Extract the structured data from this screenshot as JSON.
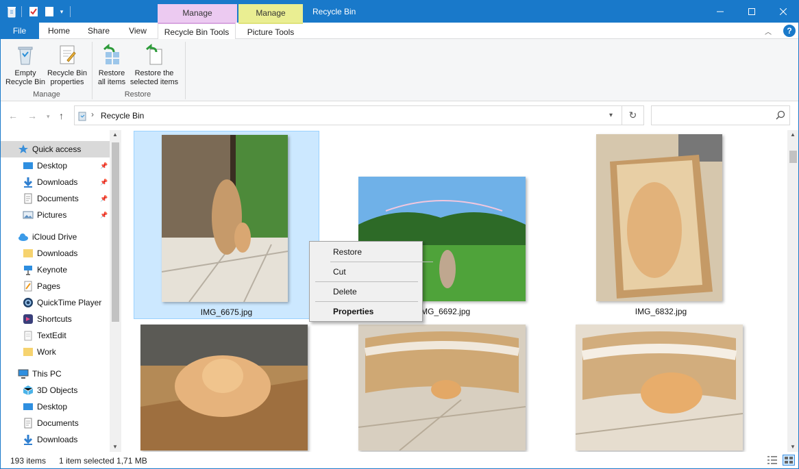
{
  "window": {
    "title": "Recycle Bin",
    "context_tabs": [
      "Manage",
      "Manage"
    ]
  },
  "ribbon_tabs": {
    "file": "File",
    "home": "Home",
    "share": "Share",
    "view": "View",
    "recycle_bin_tools": "Recycle Bin Tools",
    "picture_tools": "Picture Tools"
  },
  "ribbon": {
    "empty_bin": [
      "Empty",
      "Recycle Bin"
    ],
    "bin_props": [
      "Recycle Bin",
      "properties"
    ],
    "restore_all": [
      "Restore",
      "all items"
    ],
    "restore_selected": [
      "Restore the",
      "selected items"
    ],
    "group_manage": "Manage",
    "group_restore": "Restore"
  },
  "address": {
    "path": "Recycle Bin",
    "search_placeholder": ""
  },
  "nav": {
    "quick_access": "Quick access",
    "qa_items": [
      "Desktop",
      "Downloads",
      "Documents",
      "Pictures"
    ],
    "icloud": "iCloud Drive",
    "icloud_items": [
      "Downloads",
      "Keynote",
      "Pages",
      "QuickTime Player",
      "Shortcuts",
      "TextEdit",
      "Work"
    ],
    "this_pc": "This PC",
    "pc_items": [
      "3D Objects",
      "Desktop",
      "Documents",
      "Downloads"
    ]
  },
  "files": [
    {
      "name": "IMG_6675.jpg"
    },
    {
      "name": "IMG_6692.jpg"
    },
    {
      "name": "IMG_6832.jpg"
    }
  ],
  "context_menu": {
    "restore": "Restore",
    "cut": "Cut",
    "delete": "Delete",
    "properties": "Properties"
  },
  "status": {
    "count": "193 items",
    "selection": "1 item selected  1,71 MB"
  },
  "colors": {
    "titlebar": "#1979ca",
    "selection": "#cce8ff",
    "manage_pink": "#eccaf1",
    "manage_yellow": "#eaee92"
  }
}
